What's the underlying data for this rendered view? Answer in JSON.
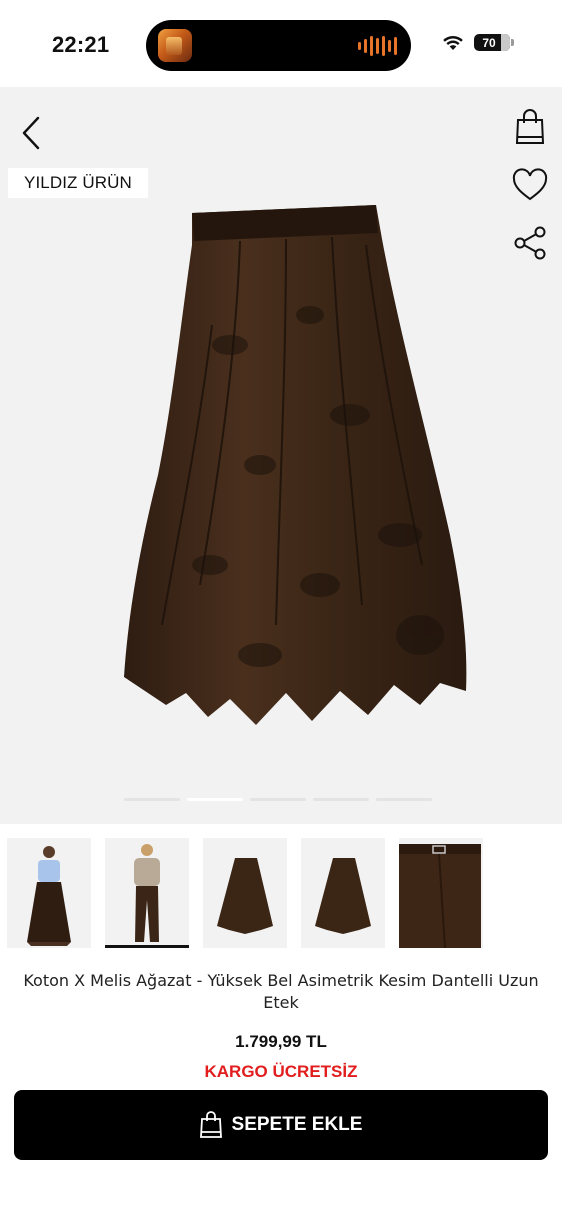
{
  "status_bar": {
    "time": "22:21",
    "battery": "70",
    "icons": [
      "now-playing-artwork-icon",
      "audio-waveform-icon",
      "wifi-icon",
      "battery-icon"
    ]
  },
  "hero": {
    "badge": "YILDIZ ÜRÜN",
    "icons": [
      "back-arrow-icon",
      "shopping-bag-icon",
      "heart-icon",
      "share-icon"
    ],
    "image_count": 5,
    "active_image": 2
  },
  "thumbnails": [
    {
      "name": "model-front"
    },
    {
      "name": "model-pants",
      "selected": true
    },
    {
      "name": "skirt-flat"
    },
    {
      "name": "skirt-flat-2"
    },
    {
      "name": "pants-detail"
    }
  ],
  "product": {
    "title": "Koton X Melis Ağazat - Yüksek Bel Asimetrik Kesim Dantelli Uzun Etek",
    "price": "1.799,99 TL",
    "shipping": "KARGO ÜCRETSİZ"
  },
  "cta": {
    "label": "SEPETE EKLE",
    "icon": "shopping-bag-icon"
  },
  "colors": {
    "accent_red": "#e11d1d",
    "button_bg": "#000000",
    "hero_bg": "#f2f2f2",
    "skirt_brown": "#3d2718"
  }
}
